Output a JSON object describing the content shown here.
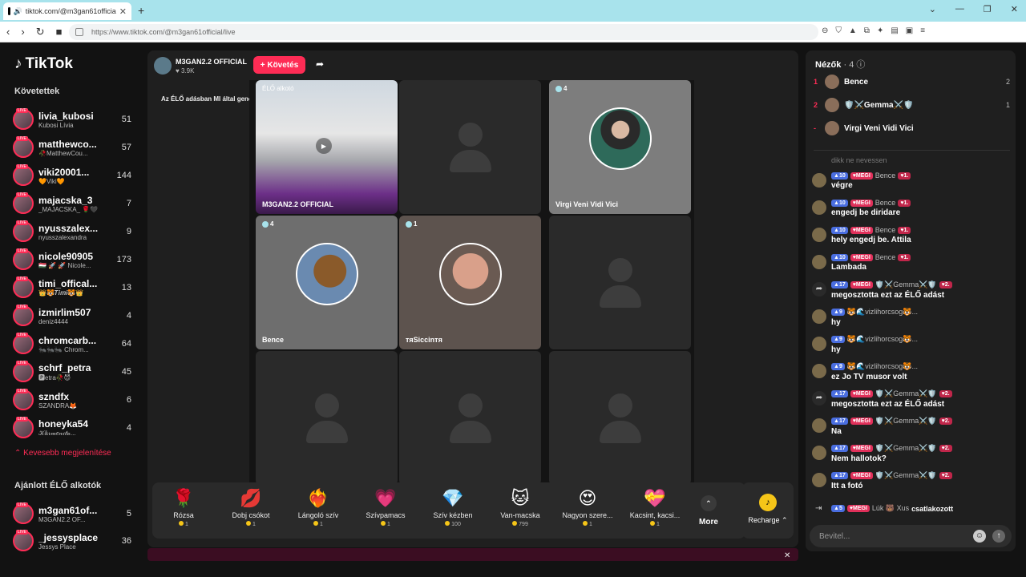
{
  "browser": {
    "tab_title": "tiktok.com/@m3gan61officia",
    "url": "https://www.tiktok.com/@m3gan61official/live"
  },
  "sidebar": {
    "logo": "TikTok",
    "following_title": "Követettek",
    "following": [
      {
        "name": "livia_kubosi",
        "sub": "Kubosi Lívia",
        "count": "51"
      },
      {
        "name": "matthewco...",
        "sub": "🥀MatthewCou...",
        "count": "57"
      },
      {
        "name": "viki20001...",
        "sub": "🧡Viki🧡",
        "count": "144"
      },
      {
        "name": "majacska_3",
        "sub": "_MAJACSKA_ 🌹🖤",
        "count": "7"
      },
      {
        "name": "nyusszalex...",
        "sub": "nyusszalexandra",
        "count": "9"
      },
      {
        "name": "nicole90905",
        "sub": "🇭🇺 🚀 🚀 Nicole...",
        "count": "173"
      },
      {
        "name": "timi_offical...",
        "sub": "👑🐯𝑻𝒊𝒎𝒊🐯👑",
        "count": "13"
      },
      {
        "name": "izmirlim507",
        "sub": "deniz4444",
        "count": "4"
      },
      {
        "name": "chromcarb...",
        "sub": "🐜🐜🐜 Chrom...",
        "count": "64"
      },
      {
        "name": "schrf_petra",
        "sub": "🅿etra🥀😈",
        "count": "45"
      },
      {
        "name": "szndfx",
        "sub": "SZANDRA🦊",
        "count": "6"
      },
      {
        "name": "honeyka54",
        "sub": "𝒦á𝓇𝓂𝑒𝓃𝒾𝓉𝒶...",
        "count": "4"
      }
    ],
    "show_less": "Kevesebb megjelenítése",
    "recommended_title": "Ajánlott ÉLŐ alkotók",
    "recommended": [
      {
        "name": "m3gan61of...",
        "sub": "M3GAN2.2 OF...",
        "count": "5"
      },
      {
        "name": "_jessysplace",
        "sub": "Jessys Place",
        "count": "36"
      }
    ]
  },
  "stream": {
    "host_name": "M3GAN2.2 OFFICIAL",
    "host_likes": "3.9K",
    "follow_label": "+ Követés",
    "ai_notice": "Az ÉLŐ adásban MI által generált tartalom szerepelhet",
    "host_cell_tag": "ÉLŐ alkotó",
    "host_cell_name": "M3GAN2.2 OFFICIAL",
    "cells": [
      {
        "name": "Virgi Veni Vidi Vici",
        "count": "4"
      },
      {
        "name": "Bence",
        "count": "4"
      },
      {
        "name": "тяSiccinтя",
        "count": "1"
      }
    ]
  },
  "gifts": [
    {
      "name": "Rózsa",
      "price": "1",
      "icon": "🌹"
    },
    {
      "name": "Dobj csókot",
      "price": "1",
      "icon": "💋"
    },
    {
      "name": "Lángoló szív",
      "price": "1",
      "icon": "❤️‍🔥"
    },
    {
      "name": "Szívpamacs",
      "price": "1",
      "icon": "💗"
    },
    {
      "name": "Szív kézben",
      "price": "100",
      "icon": "💎"
    },
    {
      "name": "Van-macska",
      "price": "799",
      "icon": "🐱"
    },
    {
      "name": "Nagyon szere...",
      "price": "1",
      "icon": "😍"
    },
    {
      "name": "Kacsint, kacsi...",
      "price": "1",
      "icon": "💝"
    }
  ],
  "more_label": "More",
  "recharge_label": "Recharge",
  "viewers": {
    "title": "Nézők",
    "count": "· 4",
    "list": [
      {
        "rank": "1",
        "name": "Bence",
        "score": "2"
      },
      {
        "rank": "2",
        "name": "🛡️⚔️Gemma⚔️🛡️",
        "score": "1"
      },
      {
        "rank": "-",
        "name": "Virgi Veni Vidi Vici",
        "score": ""
      }
    ]
  },
  "chat": {
    "faded": "dikk ne nevessen",
    "messages": [
      {
        "lvl": "10",
        "megi": "MEGI",
        "user": "Bence",
        "rank": "1.",
        "text": "végre"
      },
      {
        "lvl": "10",
        "megi": "MEGI",
        "user": "Bence",
        "rank": "1.",
        "text": "engedj be diridare"
      },
      {
        "lvl": "10",
        "megi": "MEGI",
        "user": "Bence",
        "rank": "1.",
        "text": "hely engedj be. Attila"
      },
      {
        "lvl": "10",
        "megi": "MEGI",
        "user": "Bence",
        "rank": "1.",
        "text": "Lambada"
      },
      {
        "lvl": "17",
        "megi": "MEGI",
        "user": "🛡️⚔️Gemma⚔️🛡️",
        "rank": "2.",
        "text": "megosztotta ezt az ÉLŐ adást"
      },
      {
        "lvl": "9",
        "megi": "",
        "user": "🐯🌊vizlihorcsog🐯...",
        "rank": "",
        "text": "hy"
      },
      {
        "lvl": "9",
        "megi": "",
        "user": "🐯🌊vizlihorcsog🐯...",
        "rank": "",
        "text": "hy"
      },
      {
        "lvl": "9",
        "megi": "",
        "user": "🐯🌊vizlihorcsog🐯...",
        "rank": "",
        "text": "ez Jo TV musor volt"
      },
      {
        "lvl": "17",
        "megi": "MEGI",
        "user": "🛡️⚔️Gemma⚔️🛡️",
        "rank": "2.",
        "text": "megosztotta ezt az ÉLŐ adást"
      },
      {
        "lvl": "17",
        "megi": "MEGI",
        "user": "🛡️⚔️Gemma⚔️🛡️",
        "rank": "2.",
        "text": "Na"
      },
      {
        "lvl": "17",
        "megi": "MEGI",
        "user": "🛡️⚔️Gemma⚔️🛡️",
        "rank": "2.",
        "text": "Nem hallotok?"
      },
      {
        "lvl": "17",
        "megi": "MEGI",
        "user": "🛡️⚔️Gemma⚔️🛡️",
        "rank": "2.",
        "text": "Itt a fotó"
      }
    ],
    "join": {
      "lvl": "5",
      "megi": "MEGI",
      "user": "Lúk 🐻 Xus",
      "text": "csatlakozott"
    },
    "input_placeholder": "Bevitel..."
  }
}
